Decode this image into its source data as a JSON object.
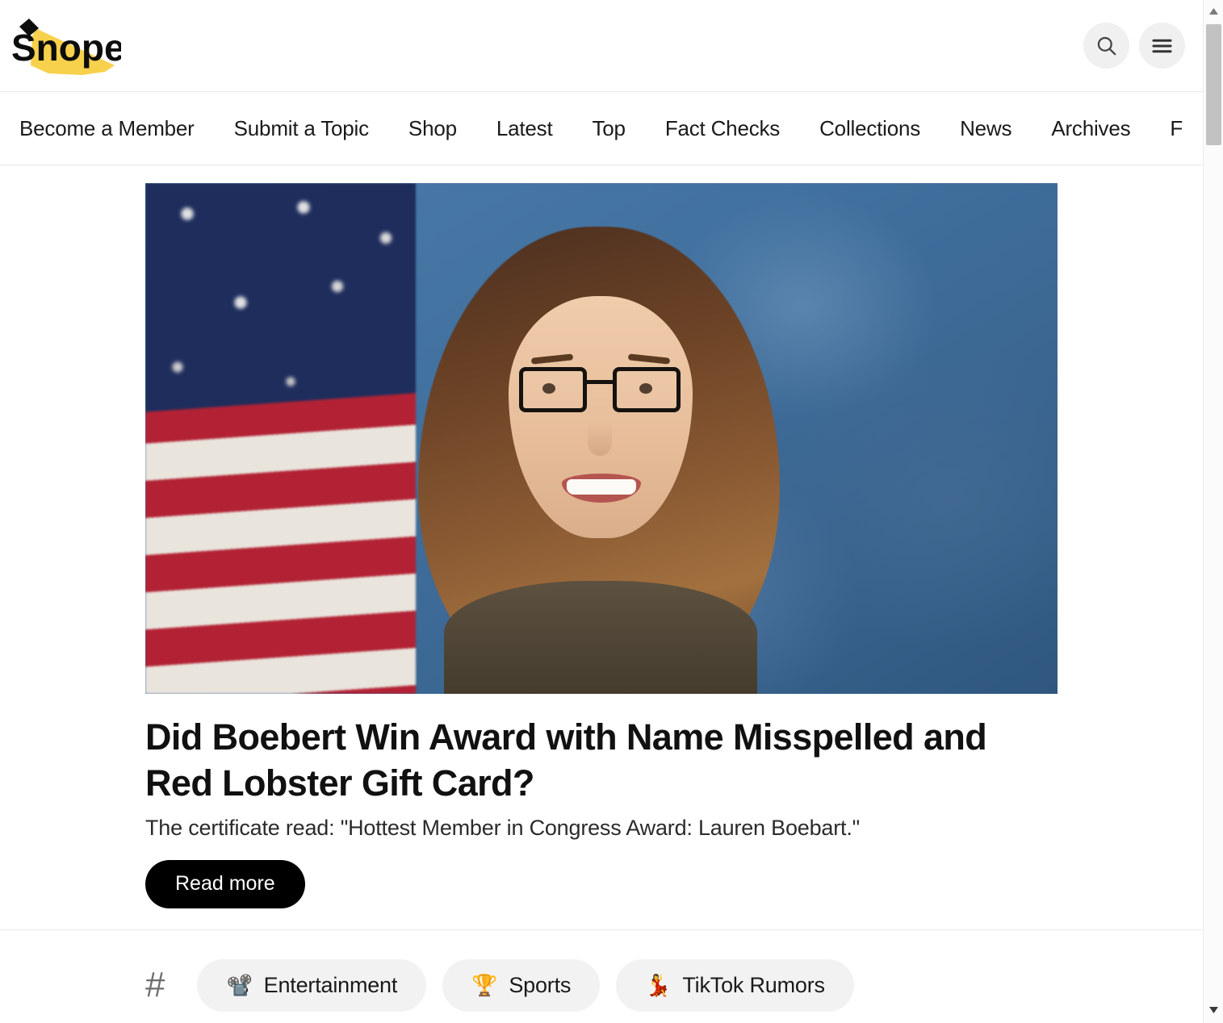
{
  "site": {
    "name": "Snopes",
    "logo_text": "Snopes",
    "logo_beam_color": "#f7d14c",
    "logo_text_color": "#0d0d0d"
  },
  "header": {
    "search_button_label": "Search",
    "menu_button_label": "Menu",
    "search_icon": "search-icon",
    "menu_icon": "hamburger-menu-icon"
  },
  "nav": {
    "items": [
      {
        "label": "Become a Member"
      },
      {
        "label": "Submit a Topic"
      },
      {
        "label": "Shop"
      },
      {
        "label": "Latest"
      },
      {
        "label": "Top"
      },
      {
        "label": "Fact Checks"
      },
      {
        "label": "Collections"
      },
      {
        "label": "News"
      },
      {
        "label": "Archives"
      },
      {
        "label": "F"
      }
    ]
  },
  "featured": {
    "image_alt": "Lauren Boebert official portrait in front of an American flag",
    "title": "Did Boebert Win Award with Name Misspelled and Red Lobster Gift Card?",
    "subtitle": "The certificate read: \"Hottest Member in Congress Award: Lauren Boebart.\"",
    "read_more_label": "Read more"
  },
  "tags": {
    "hash_symbol": "#",
    "items": [
      {
        "emoji": "📽️",
        "icon_name": "film-projector-icon",
        "label": "Entertainment"
      },
      {
        "emoji": "🏆",
        "icon_name": "trophy-icon",
        "label": "Sports"
      },
      {
        "emoji": "💃",
        "icon_name": "dancer-icon",
        "label": "TikTok Rumors"
      }
    ]
  },
  "scrollbar": {
    "up_arrow": "▲",
    "down_arrow": "▼"
  },
  "colors": {
    "accent_yellow": "#f7d14c",
    "button_black": "#000000",
    "chip_gray": "#f2f2f2",
    "divider": "#e8e8e8"
  }
}
